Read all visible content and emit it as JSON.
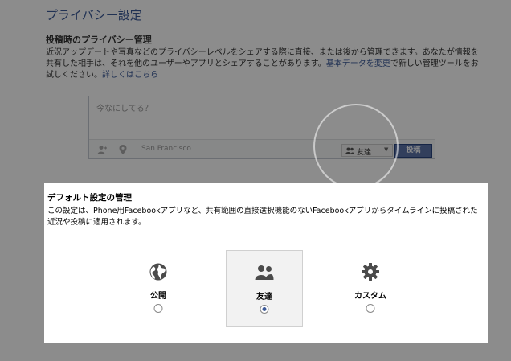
{
  "page": {
    "title": "プライバシー設定",
    "section_heading": "投稿時のプライバシー管理",
    "section_desc_text": "近況アップデートや写真などのプライバシーレベルをシェアする際に直接、または後から管理できます。あなたが情報を共有した相手は、それを他のユーザーやアプリとシェアすることがあります。",
    "section_desc_link1": "基本データを変更",
    "section_desc_mid": "で新しい管理ツールをお試しください。",
    "section_desc_link2": "詳しくはこちら"
  },
  "composer": {
    "placeholder": "今なにしてる？",
    "location": "San Francisco",
    "audience_label": "友達",
    "post_label": "投稿"
  },
  "dialog": {
    "title": "デフォルト設定の管理",
    "description": "この設定は、Phone用Facebookアプリなど、共有範囲の直接選択機能のないFacebookアプリからタイムラインに投稿された近況や投稿に適用されます。",
    "options": [
      {
        "label": "公開",
        "icon": "globe-icon",
        "selected": false
      },
      {
        "label": "友達",
        "icon": "friends-icon",
        "selected": true
      },
      {
        "label": "カスタム",
        "icon": "gear-icon",
        "selected": false
      }
    ]
  }
}
